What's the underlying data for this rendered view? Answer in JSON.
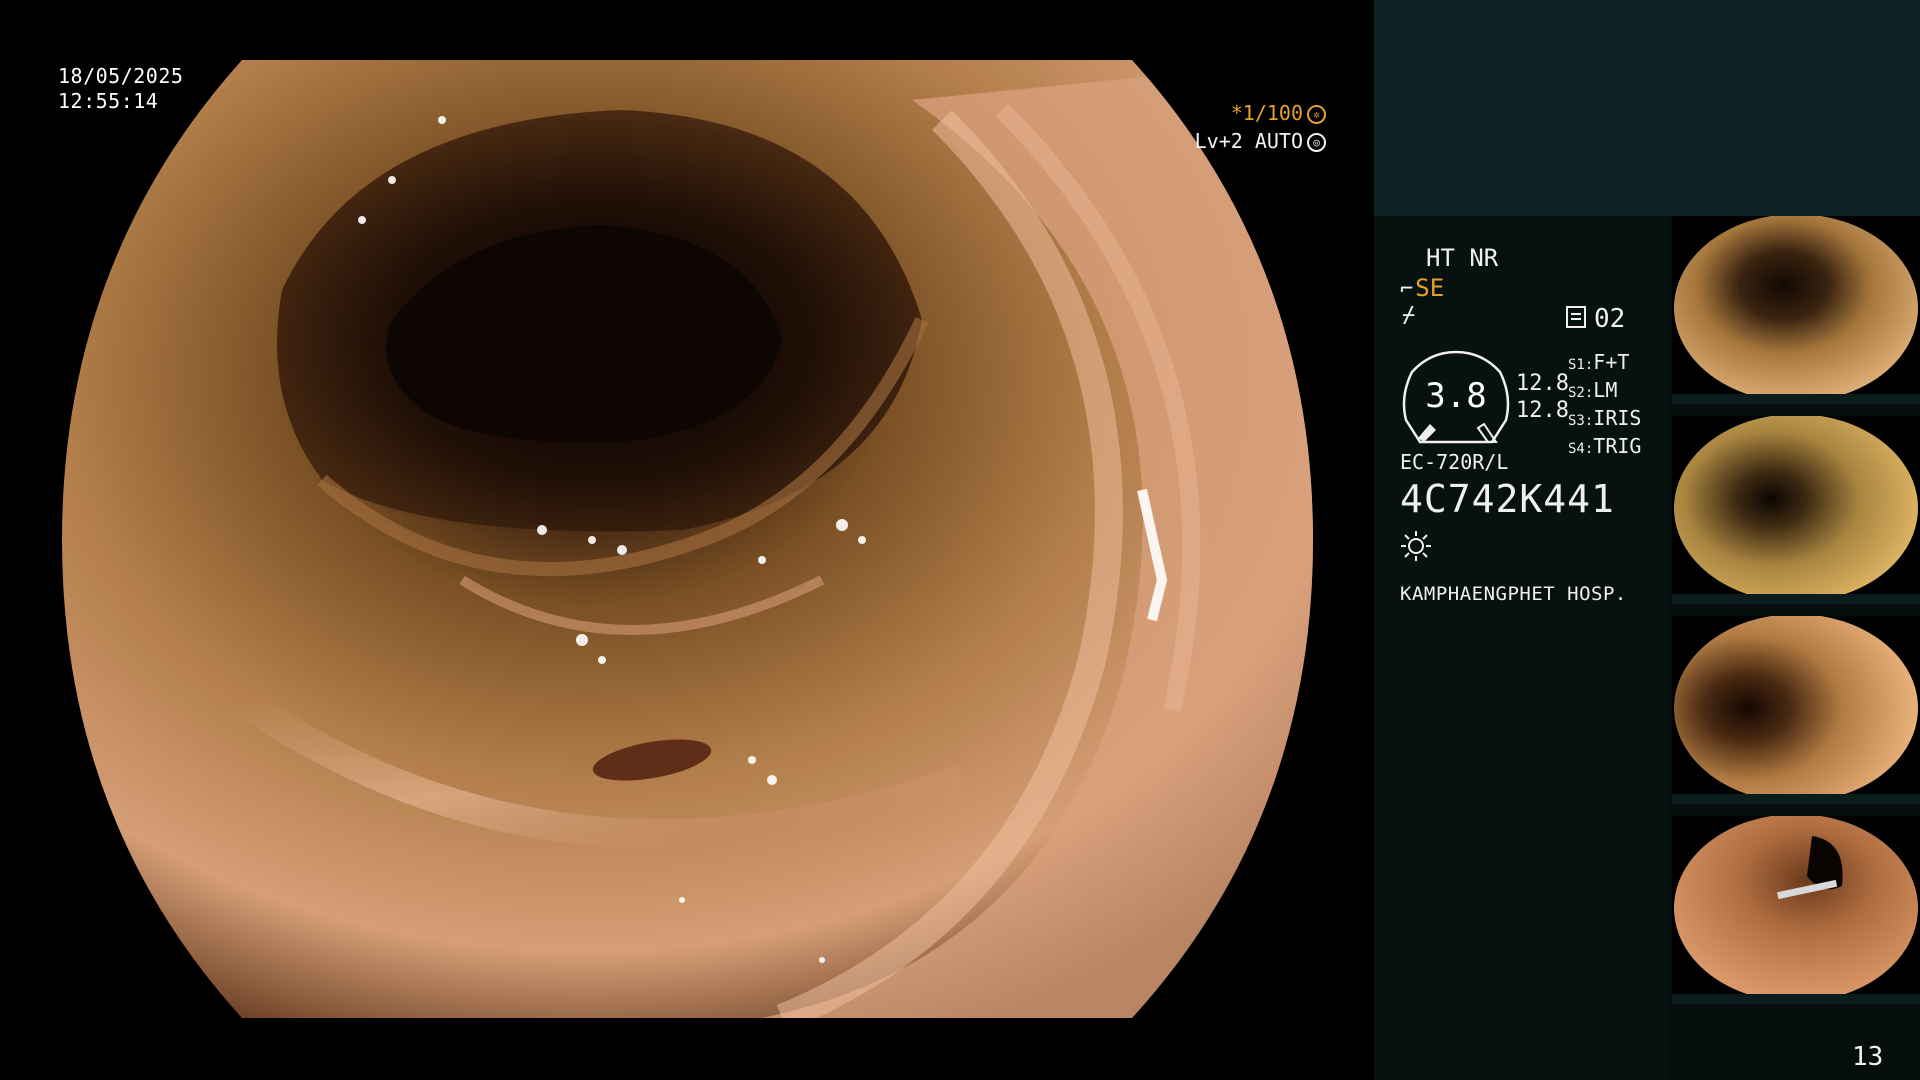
{
  "overlay": {
    "date": "18/05/2025",
    "time": "12:55:14",
    "shutter": "*1/100",
    "level": "Lv+2 AUTO"
  },
  "panel": {
    "mode_ht": "HT NR",
    "mode_se": "SE",
    "mode_f": "f",
    "counter": "02",
    "gauge_value": "3.8",
    "zoom_1": "12.8",
    "zoom_2": "12.8",
    "switches": [
      {
        "key": "S1:",
        "value": "F+T"
      },
      {
        "key": "S2:",
        "value": "LM"
      },
      {
        "key": "S3:",
        "value": "IRIS"
      },
      {
        "key": "S4:",
        "value": "TRIG"
      }
    ],
    "scope_model": "EC-720R/L",
    "serial": "4C742K441",
    "hospital": "KAMPHAENGPHET HOSP.",
    "page_number": "13"
  },
  "colors": {
    "accent": "#e6a12c",
    "panel_header": "#0d2324",
    "panel_body": "#071110"
  },
  "icons": [
    "shutter-icon",
    "auto-iris-icon",
    "freeze-icon",
    "counter-icon",
    "light-icon"
  ]
}
